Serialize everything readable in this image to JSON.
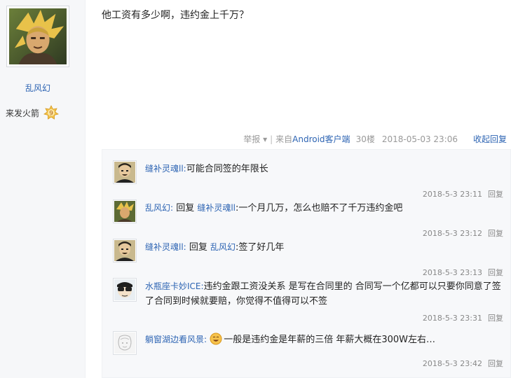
{
  "author": {
    "name": "乱风幻",
    "rank_title": "来发火箭",
    "rank_level": "9"
  },
  "post": {
    "content": "他工资有多少啊，违约金上千万？",
    "report_label": "举报 ▾",
    "separator": "|",
    "client_prefix": "来自",
    "client_name": "Android客户端",
    "floor": "30楼",
    "datetime": "2018-05-03 23:06",
    "toggle_reply_label": "收起回复"
  },
  "comments": [
    {
      "user": "缝补灵魂ll:",
      "text": "可能合同签的年限长",
      "time": "2018-5-3 23:11",
      "reply_label": "回复"
    },
    {
      "user": "乱风幻:",
      "reply_word": "回复",
      "reply_to": "缝补灵魂ll",
      "text": ":一个月几万，怎么也赔不了千万违约金吧",
      "time": "2018-5-3 23:12",
      "reply_label": "回复"
    },
    {
      "user": "缝补灵魂ll:",
      "reply_word": "回复",
      "reply_to": "乱风幻",
      "text": ":签了好几年",
      "time": "2018-5-3 23:13",
      "reply_label": "回复"
    },
    {
      "user": "水瓶座卡妙ICE:",
      "text": "违约金跟工资没关系 是写在合同里的 合同写一个亿都可以只要你同意了签了合同到时候就要赔，你觉得不值得可以不签",
      "time": "2018-5-3 23:31",
      "reply_label": "回复"
    },
    {
      "user": "躺窗湖边看风景:",
      "text": "一般是违约金是年薪的三倍 年薪大概在300W左右…",
      "time": "2018-5-3 23:42",
      "reply_label": "回复"
    }
  ]
}
